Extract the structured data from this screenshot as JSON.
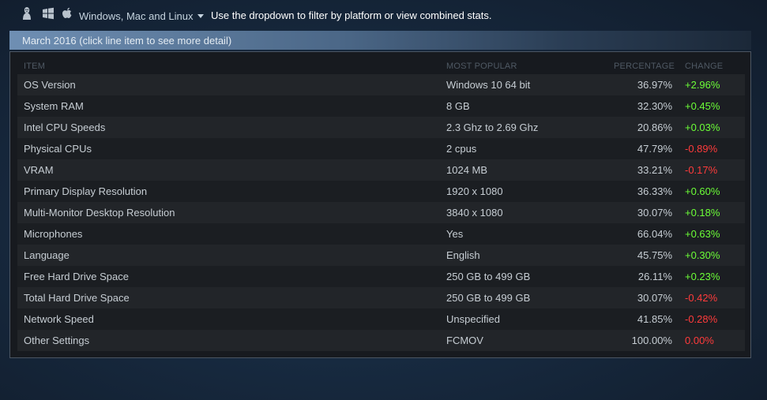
{
  "platforms": {
    "icons": [
      "linux-icon",
      "windows-icon",
      "apple-icon"
    ],
    "selected": "Windows, Mac and Linux",
    "hint": "Use the dropdown to filter by platform or view combined stats."
  },
  "period": {
    "title": "March 2016 (click line item to see more detail)"
  },
  "table": {
    "headers": {
      "item": "ITEM",
      "popular": "MOST POPULAR",
      "percentage": "PERCENTAGE",
      "change": "CHANGE"
    },
    "rows": [
      {
        "item": "OS Version",
        "popular": "Windows 10 64 bit",
        "percentage": "36.97%",
        "change": "+2.96%",
        "trend": "up"
      },
      {
        "item": "System RAM",
        "popular": "8 GB",
        "percentage": "32.30%",
        "change": "+0.45%",
        "trend": "up"
      },
      {
        "item": "Intel CPU Speeds",
        "popular": "2.3 Ghz to 2.69 Ghz",
        "percentage": "20.86%",
        "change": "+0.03%",
        "trend": "up"
      },
      {
        "item": "Physical CPUs",
        "popular": "2 cpus",
        "percentage": "47.79%",
        "change": "-0.89%",
        "trend": "down"
      },
      {
        "item": "VRAM",
        "popular": "1024 MB",
        "percentage": "33.21%",
        "change": "-0.17%",
        "trend": "down"
      },
      {
        "item": "Primary Display Resolution",
        "popular": "1920 x 1080",
        "percentage": "36.33%",
        "change": "+0.60%",
        "trend": "up"
      },
      {
        "item": "Multi-Monitor Desktop Resolution",
        "popular": "3840 x 1080",
        "percentage": "30.07%",
        "change": "+0.18%",
        "trend": "up"
      },
      {
        "item": "Microphones",
        "popular": "Yes",
        "percentage": "66.04%",
        "change": "+0.63%",
        "trend": "up"
      },
      {
        "item": "Language",
        "popular": "English",
        "percentage": "45.75%",
        "change": "+0.30%",
        "trend": "up"
      },
      {
        "item": "Free Hard Drive Space",
        "popular": "250 GB to 499 GB",
        "percentage": "26.11%",
        "change": "+0.23%",
        "trend": "up"
      },
      {
        "item": "Total Hard Drive Space",
        "popular": "250 GB to 499 GB",
        "percentage": "30.07%",
        "change": "-0.42%",
        "trend": "down"
      },
      {
        "item": "Network Speed",
        "popular": "Unspecified",
        "percentage": "41.85%",
        "change": "-0.28%",
        "trend": "down"
      },
      {
        "item": "Other Settings",
        "popular": "FCMOV",
        "percentage": "100.00%",
        "change": "0.00%",
        "trend": "down"
      }
    ]
  },
  "colors": {
    "positive": "#6cff37",
    "negative": "#ff3b3b"
  }
}
